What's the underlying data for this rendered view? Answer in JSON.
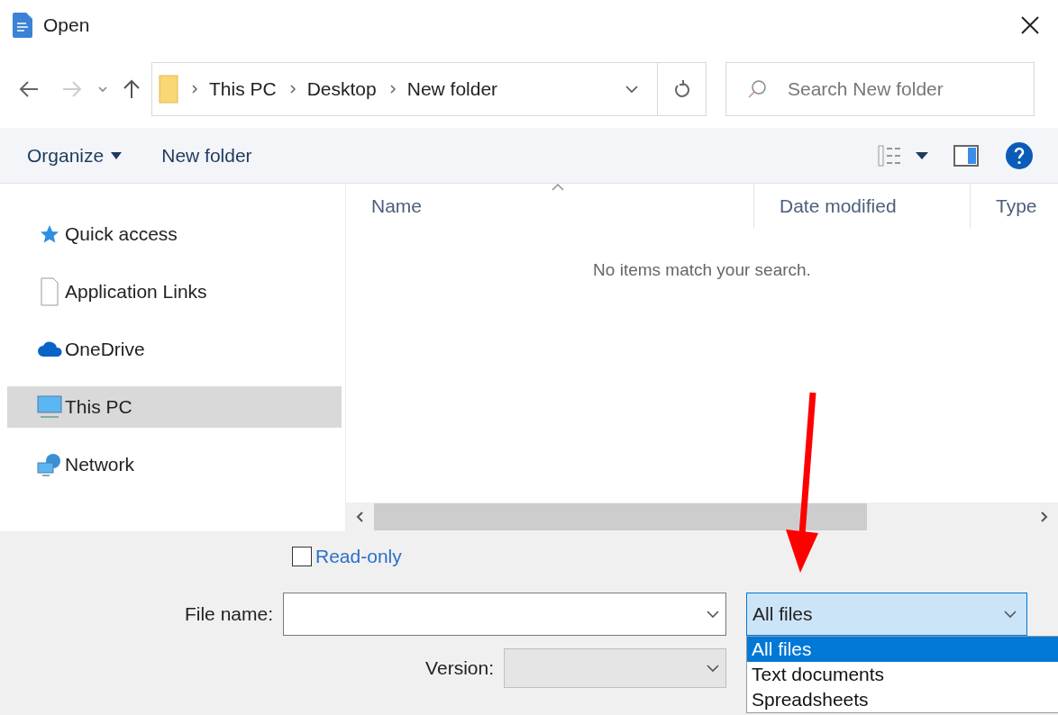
{
  "window": {
    "title": "Open"
  },
  "address_bar": {
    "path": [
      "This PC",
      "Desktop",
      "New folder"
    ]
  },
  "search": {
    "placeholder": "Search New folder"
  },
  "toolbar": {
    "items": [
      "Organize",
      "New folder"
    ]
  },
  "sidebar": {
    "items": [
      {
        "label": "Quick access",
        "kind": "star",
        "selected": false
      },
      {
        "label": "Application Links",
        "kind": "page",
        "selected": false
      },
      {
        "label": "OneDrive",
        "kind": "cloud",
        "selected": false
      },
      {
        "label": "This PC",
        "kind": "monitor",
        "selected": true
      },
      {
        "label": "Network",
        "kind": "network",
        "selected": false
      }
    ]
  },
  "file_list": {
    "columns": [
      "Name",
      "Date modified",
      "Type"
    ],
    "empty_message": "No items match your search."
  },
  "read_only": {
    "label": "Read-only",
    "checked": false
  },
  "file_name": {
    "label": "File name:"
  },
  "version": {
    "label": "Version:",
    "disabled": true
  },
  "file_type": {
    "value": "All files",
    "expanded": true,
    "options": [
      {
        "label": "All files",
        "selected": true
      },
      {
        "label": "Text documents",
        "selected": false
      },
      {
        "label": "Spreadsheets",
        "selected": false
      }
    ]
  }
}
